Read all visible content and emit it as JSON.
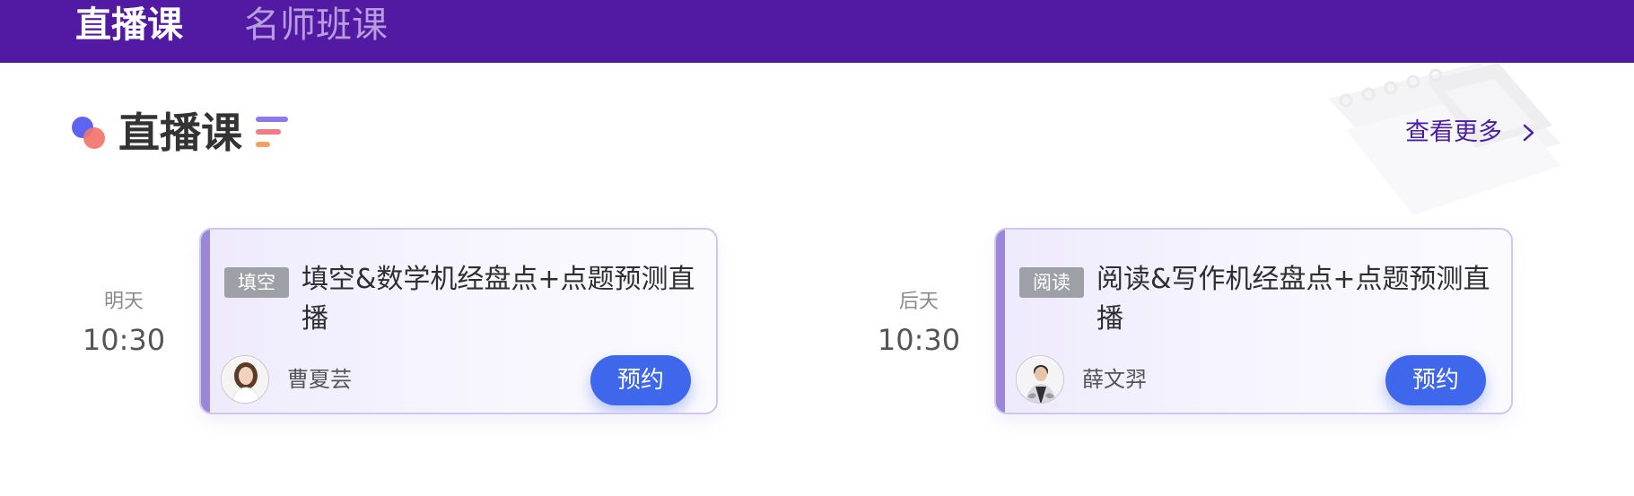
{
  "tabs": {
    "active": "直播课",
    "inactive": "名师班课"
  },
  "section": {
    "title": "直播课",
    "see_more": "查看更多",
    "icon": "chevron-right-icon"
  },
  "colors": {
    "topbar": "#5219a3",
    "accent_purple": "#4b1ea8",
    "button_blue": "#3f67ec",
    "tag_gray": "#9ea0a7"
  },
  "courses": [
    {
      "day": "明天",
      "time": "10:30",
      "tag": "填空",
      "title": "填空&数学机经盘点+点题预测直播",
      "teacher": "曹夏芸",
      "button": "预约"
    },
    {
      "day": "后天",
      "time": "10:30",
      "tag": "阅读",
      "title": "阅读&写作机经盘点+点题预测直播",
      "teacher": "薛文羿",
      "button": "预约"
    }
  ]
}
